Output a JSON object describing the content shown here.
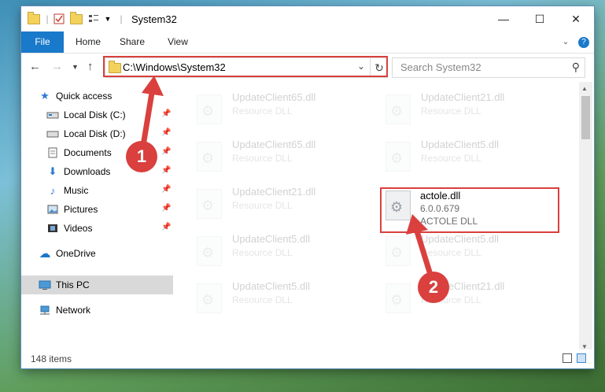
{
  "window": {
    "title": "System32"
  },
  "titlebar": {
    "minimize": "—",
    "maximize": "☐",
    "close": "✕"
  },
  "ribbon": {
    "tabs": [
      "File",
      "Home",
      "Share",
      "View"
    ]
  },
  "address": {
    "path": "C:\\Windows\\System32"
  },
  "search": {
    "placeholder": "Search System32"
  },
  "sidebar": {
    "items": [
      {
        "label": "Quick access",
        "icon": "star-icon"
      },
      {
        "label": "Local Disk (C:)",
        "icon": "drive-icon"
      },
      {
        "label": "Local Disk (D:)",
        "icon": "drive-icon"
      },
      {
        "label": "Documents",
        "icon": "documents-icon"
      },
      {
        "label": "Downloads",
        "icon": "downloads-icon"
      },
      {
        "label": "Music",
        "icon": "music-icon"
      },
      {
        "label": "Pictures",
        "icon": "pictures-icon"
      },
      {
        "label": "Videos",
        "icon": "videos-icon"
      },
      {
        "label": "OneDrive",
        "icon": "cloud-icon"
      },
      {
        "label": "This PC",
        "icon": "computer-icon"
      },
      {
        "label": "Network",
        "icon": "network-icon"
      }
    ]
  },
  "files": [
    {
      "name": "UpdateClient65.dll",
      "type": "Resource DLL"
    },
    {
      "name": "UpdateClient21.dll",
      "type": "Resource DLL"
    },
    {
      "name": "UpdateClient65.dll",
      "type": "Resource DLL"
    },
    {
      "name": "UpdateClient5.dll",
      "type": "Resource DLL"
    },
    {
      "name": "UpdateClient21.dll",
      "type": "Resource DLL"
    },
    {
      "name": "actole.dll",
      "version": "6.0.0.679",
      "description": "ACTOLE DLL"
    },
    {
      "name": "UpdateClient5.dll",
      "type": "Resource DLL"
    },
    {
      "name": "UpdateClient5.dll",
      "type": "Resource DLL"
    },
    {
      "name": "UpdateClient5.dll",
      "type": "Resource DLL"
    },
    {
      "name": "UpdateClient21.dll",
      "type": "Resource DLL"
    }
  ],
  "status": {
    "item_count": "148 items"
  },
  "annotations": {
    "step1": "1",
    "step2": "2"
  },
  "colors": {
    "accent": "#1979ca",
    "highlight": "#d9403e"
  }
}
